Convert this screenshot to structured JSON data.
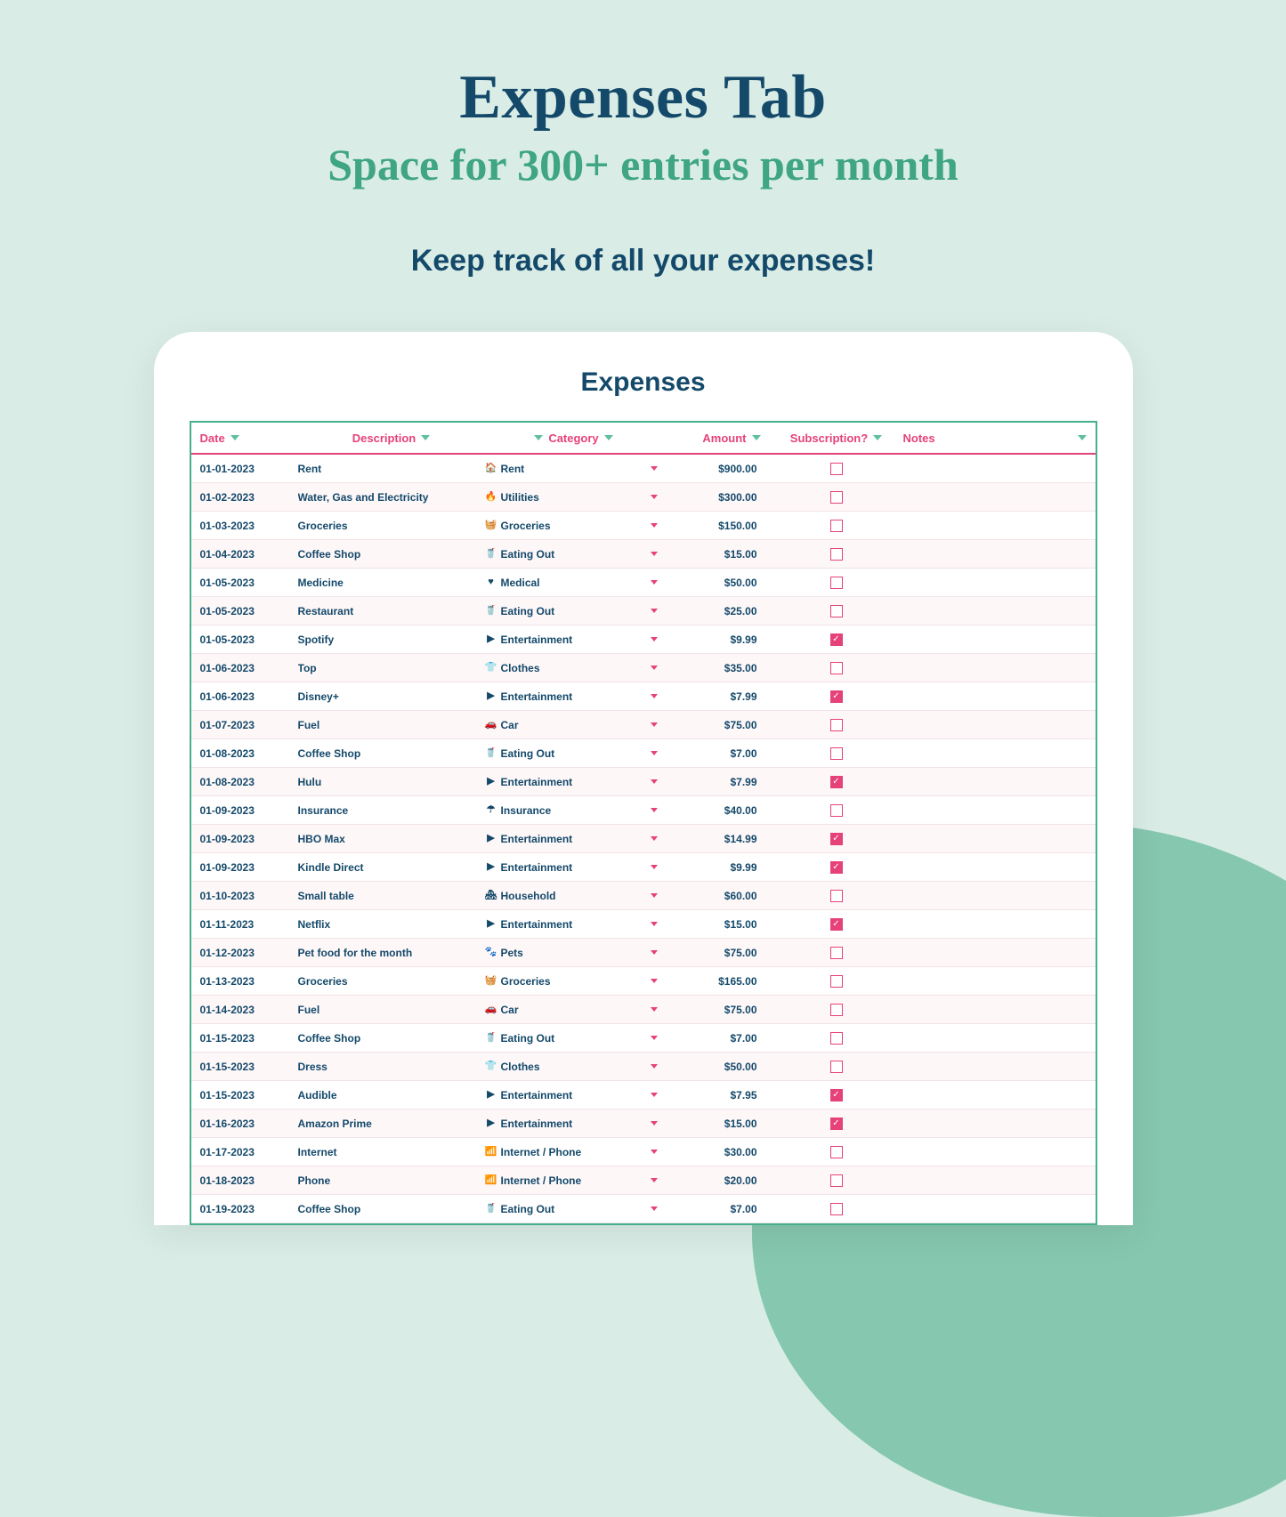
{
  "hero": {
    "title": "Expenses Tab",
    "subtitle": "Space for 300+ entries per month",
    "tagline": "Keep track of all your expenses!"
  },
  "sheet": {
    "title": "Expenses",
    "headers": {
      "date": "Date",
      "description": "Description",
      "category": "Category",
      "amount": "Amount",
      "subscription": "Subscription?",
      "notes": "Notes"
    }
  },
  "category_icons": {
    "Rent": "🏠",
    "Utilities": "🔥",
    "Groceries": "🧺",
    "Eating Out": "🥤",
    "Medical": "♥",
    "Entertainment": "▶",
    "Clothes": "👕",
    "Car": "🚗",
    "Insurance": "☂",
    "Household": "🏘",
    "Pets": "🐾",
    "Internet / Phone": "📶"
  },
  "rows": [
    {
      "date": "01-01-2023",
      "description": "Rent",
      "category": "Rent",
      "amount": "$900.00",
      "subscription": false,
      "notes": ""
    },
    {
      "date": "01-02-2023",
      "description": "Water, Gas and Electricity",
      "category": "Utilities",
      "amount": "$300.00",
      "subscription": false,
      "notes": ""
    },
    {
      "date": "01-03-2023",
      "description": "Groceries",
      "category": "Groceries",
      "amount": "$150.00",
      "subscription": false,
      "notes": ""
    },
    {
      "date": "01-04-2023",
      "description": "Coffee Shop",
      "category": "Eating Out",
      "amount": "$15.00",
      "subscription": false,
      "notes": ""
    },
    {
      "date": "01-05-2023",
      "description": "Medicine",
      "category": "Medical",
      "amount": "$50.00",
      "subscription": false,
      "notes": ""
    },
    {
      "date": "01-05-2023",
      "description": "Restaurant",
      "category": "Eating Out",
      "amount": "$25.00",
      "subscription": false,
      "notes": ""
    },
    {
      "date": "01-05-2023",
      "description": "Spotify",
      "category": "Entertainment",
      "amount": "$9.99",
      "subscription": true,
      "notes": ""
    },
    {
      "date": "01-06-2023",
      "description": "Top",
      "category": "Clothes",
      "amount": "$35.00",
      "subscription": false,
      "notes": ""
    },
    {
      "date": "01-06-2023",
      "description": "Disney+",
      "category": "Entertainment",
      "amount": "$7.99",
      "subscription": true,
      "notes": ""
    },
    {
      "date": "01-07-2023",
      "description": "Fuel",
      "category": "Car",
      "amount": "$75.00",
      "subscription": false,
      "notes": ""
    },
    {
      "date": "01-08-2023",
      "description": "Coffee Shop",
      "category": "Eating Out",
      "amount": "$7.00",
      "subscription": false,
      "notes": ""
    },
    {
      "date": "01-08-2023",
      "description": "Hulu",
      "category": "Entertainment",
      "amount": "$7.99",
      "subscription": true,
      "notes": ""
    },
    {
      "date": "01-09-2023",
      "description": "Insurance",
      "category": "Insurance",
      "amount": "$40.00",
      "subscription": false,
      "notes": ""
    },
    {
      "date": "01-09-2023",
      "description": "HBO Max",
      "category": "Entertainment",
      "amount": "$14.99",
      "subscription": true,
      "notes": ""
    },
    {
      "date": "01-09-2023",
      "description": "Kindle Direct",
      "category": "Entertainment",
      "amount": "$9.99",
      "subscription": true,
      "notes": ""
    },
    {
      "date": "01-10-2023",
      "description": "Small table",
      "category": "Household",
      "amount": "$60.00",
      "subscription": false,
      "notes": ""
    },
    {
      "date": "01-11-2023",
      "description": "Netflix",
      "category": "Entertainment",
      "amount": "$15.00",
      "subscription": true,
      "notes": ""
    },
    {
      "date": "01-12-2023",
      "description": "Pet food for the month",
      "category": "Pets",
      "amount": "$75.00",
      "subscription": false,
      "notes": ""
    },
    {
      "date": "01-13-2023",
      "description": "Groceries",
      "category": "Groceries",
      "amount": "$165.00",
      "subscription": false,
      "notes": ""
    },
    {
      "date": "01-14-2023",
      "description": "Fuel",
      "category": "Car",
      "amount": "$75.00",
      "subscription": false,
      "notes": ""
    },
    {
      "date": "01-15-2023",
      "description": "Coffee Shop",
      "category": "Eating Out",
      "amount": "$7.00",
      "subscription": false,
      "notes": ""
    },
    {
      "date": "01-15-2023",
      "description": "Dress",
      "category": "Clothes",
      "amount": "$50.00",
      "subscription": false,
      "notes": ""
    },
    {
      "date": "01-15-2023",
      "description": "Audible",
      "category": "Entertainment",
      "amount": "$7.95",
      "subscription": true,
      "notes": ""
    },
    {
      "date": "01-16-2023",
      "description": "Amazon Prime",
      "category": "Entertainment",
      "amount": "$15.00",
      "subscription": true,
      "notes": ""
    },
    {
      "date": "01-17-2023",
      "description": "Internet",
      "category": "Internet / Phone",
      "amount": "$30.00",
      "subscription": false,
      "notes": ""
    },
    {
      "date": "01-18-2023",
      "description": "Phone",
      "category": "Internet / Phone",
      "amount": "$20.00",
      "subscription": false,
      "notes": ""
    },
    {
      "date": "01-19-2023",
      "description": "Coffee Shop",
      "category": "Eating Out",
      "amount": "$7.00",
      "subscription": false,
      "notes": ""
    }
  ]
}
